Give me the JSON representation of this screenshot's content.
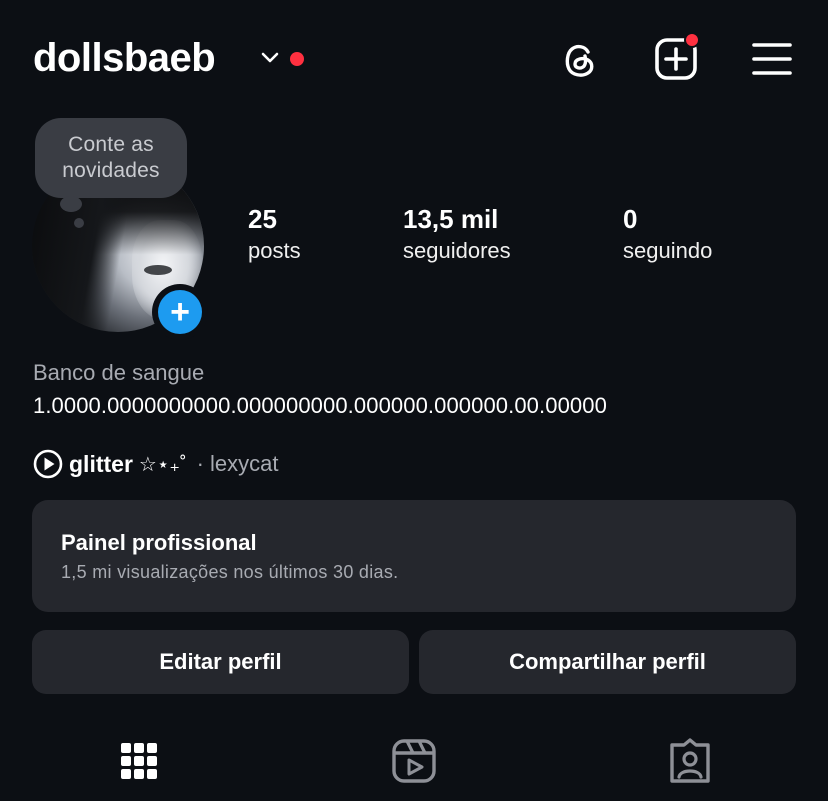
{
  "header": {
    "username": "dollsbaeb",
    "icons": [
      "chevron-down-icon",
      "threads-icon",
      "create-icon",
      "menu-icon"
    ]
  },
  "note": {
    "text_line1": "Conte as",
    "text_line2": "novidades"
  },
  "stats": {
    "posts": {
      "count": "25",
      "label": "posts"
    },
    "followers": {
      "count": "13,5 mil",
      "label": "seguidores"
    },
    "following": {
      "count": "0",
      "label": "seguindo"
    }
  },
  "bio": {
    "category": "Banco de sangue",
    "text": "1.0000.0000000000.000000000.000000.000000.00.00000"
  },
  "music": {
    "song": "glitter",
    "decoration": "☆⋆₊˚",
    "artist": "· lexycat"
  },
  "dashboard": {
    "title": "Painel profissional",
    "subtitle": "1,5 mi visualizações nos últimos 30 dias."
  },
  "actions": {
    "edit_label": "Editar perfil",
    "share_label": "Compartilhar perfil"
  },
  "tabs": [
    "grid-icon",
    "reels-icon",
    "tagged-icon"
  ],
  "colors": {
    "background": "#0c0f14",
    "card": "#25272d",
    "accent_blue": "#1d9bf0",
    "notification_red": "#ff3040"
  }
}
